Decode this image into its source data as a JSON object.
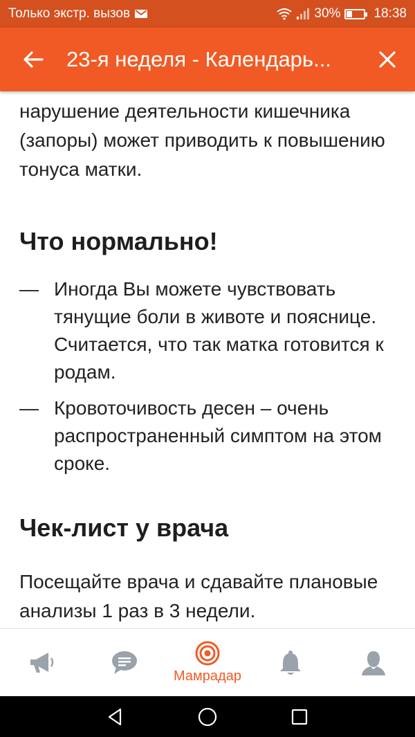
{
  "status_bar": {
    "carrier": "Только экстр. вызов",
    "battery": "30%",
    "time": "18:38"
  },
  "app_bar": {
    "title": "23-я неделя - Календарь..."
  },
  "content": {
    "intro_text": "нарушение деятельности кишечника (запоры) может приводить к повышению тонуса матки.",
    "section1_title": "Что нормально!",
    "bullets": [
      "Иногда Вы можете чувствовать тянущие боли в животе и пояснице. Считается, что так матка готовится к родам.",
      "Кровоточивость десен – очень распространенный симптом на этом сроке."
    ],
    "section2_title": "Чек-лист у врача",
    "section2_text": "Посещайте врача и сдавайте плановые анализы 1 раз в 3 недели."
  },
  "bottom_nav": {
    "active_label": "Мамрадар",
    "icons": [
      "megaphone-icon",
      "chat-icon",
      "target-icon",
      "bell-icon",
      "profile-icon"
    ]
  },
  "colors": {
    "accent": "#f15a24",
    "status_bar": "#d4501f",
    "nav_icon": "#9aa3ab"
  }
}
